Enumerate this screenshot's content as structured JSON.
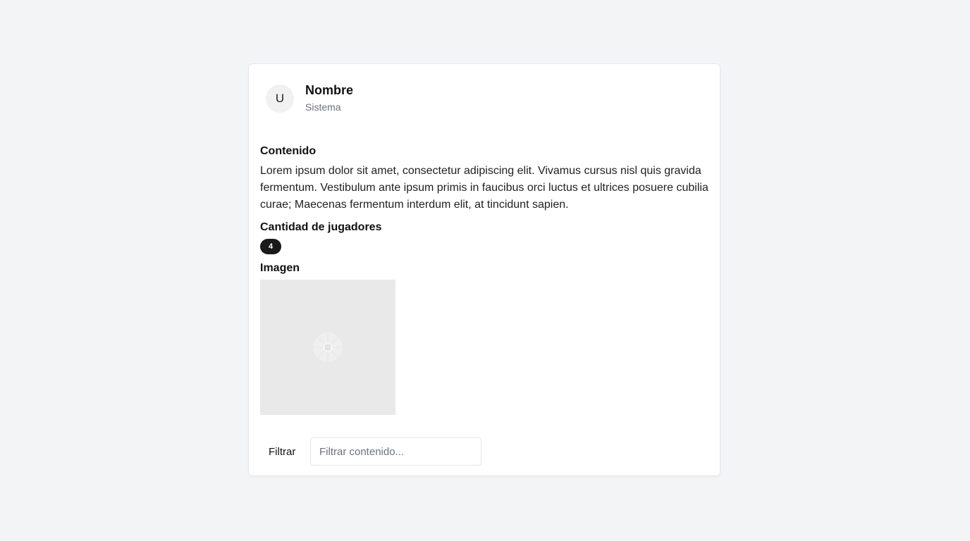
{
  "profile": {
    "avatar_initial": "U",
    "name": "Nombre",
    "role": "Sistema"
  },
  "content": {
    "label": "Contenido",
    "text": "Lorem ipsum dolor sit amet, consectetur adipiscing elit. Vivamus cursus nisl quis gravida fermentum. Vestibulum ante ipsum primis in faucibus orci luctus et ultrices posuere cubilia curae; Maecenas fermentum interdum elit, at tincidunt sapien."
  },
  "players": {
    "label": "Cantidad de jugadores",
    "count": "4"
  },
  "image": {
    "label": "Imagen",
    "icon": "image-placeholder-icon"
  },
  "filter": {
    "label": "Filtrar",
    "value": "",
    "placeholder": "Filtrar contenido..."
  },
  "colors": {
    "page_background": "#f3f4f6",
    "card_background": "#ffffff",
    "badge_background": "#1a1a1a",
    "muted_text": "#6b7280"
  }
}
